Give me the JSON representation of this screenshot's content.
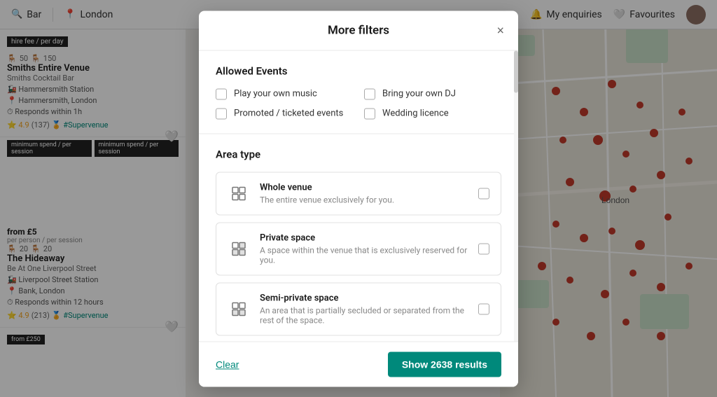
{
  "nav": {
    "search_type": "Bar",
    "location": "London",
    "enquiries_label": "My enquiries",
    "favourites_label": "Favourites"
  },
  "listings": [
    {
      "price_tag": "hire fee / per day",
      "capacity_min": 50,
      "capacity_max": 150,
      "name": "Smiths Entire Venue",
      "sub": "Smiths Cocktail Bar",
      "station": "Hammersmith Station",
      "location": "Hammersmith, London",
      "response": "Responds within 1h",
      "rating": "4.9",
      "review_count": "137",
      "badge": "#Supervenue"
    },
    {
      "price_tag": "minimum spend / per session",
      "price_from": "from £5",
      "price_sub": "per person / per session",
      "capacity_min": 20,
      "capacity_max": 20,
      "name": "The Hideaway",
      "sub": "Be At One Liverpool Street",
      "station": "Liverpool Street Station",
      "location": "Bank, London",
      "response": "Responds within 12 hours",
      "rating": "4.9",
      "review_count": "213",
      "badge": "#Supervenue"
    }
  ],
  "modal": {
    "title": "More filters",
    "close_label": "×",
    "sections": {
      "allowed_events": {
        "title": "Allowed Events",
        "options": [
          {
            "label": "Play your own music",
            "checked": false
          },
          {
            "label": "Bring your own DJ",
            "checked": false
          },
          {
            "label": "Promoted / ticketed events",
            "checked": false
          },
          {
            "label": "Wedding licence",
            "checked": false
          }
        ]
      },
      "area_type": {
        "title": "Area type",
        "options": [
          {
            "name": "Whole venue",
            "description": "The entire venue exclusively for you.",
            "checked": false,
            "icon": "grid-4"
          },
          {
            "name": "Private space",
            "description": "A space within the venue that is exclusively reserved for you.",
            "checked": false,
            "icon": "grid-partial"
          },
          {
            "name": "Semi-private space",
            "description": "An area that is partially secluded or separated from the rest of the space.",
            "checked": false,
            "icon": "grid-partial-2"
          }
        ]
      }
    },
    "footer": {
      "clear_label": "Clear",
      "results_label": "Show 2638 results",
      "results_count": 2638
    }
  }
}
